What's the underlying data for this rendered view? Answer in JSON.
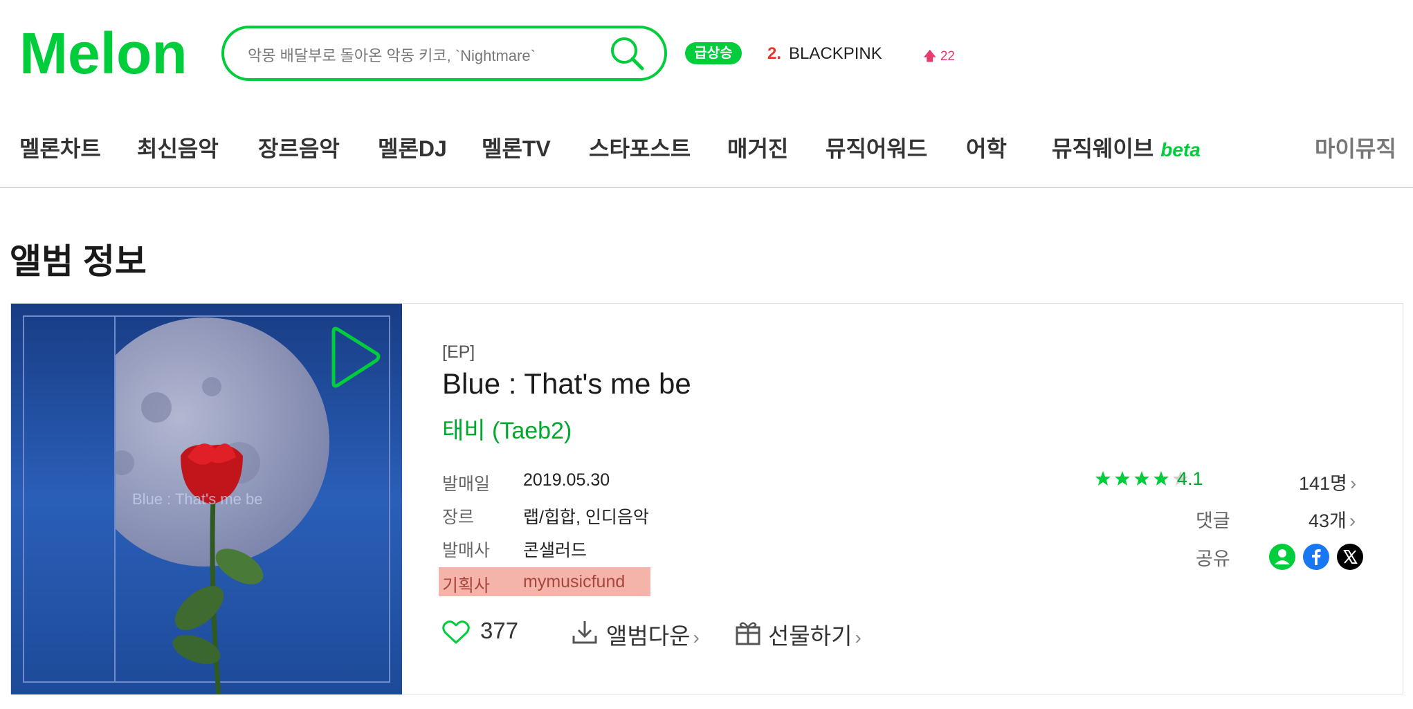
{
  "header": {
    "logo_text": "Melon",
    "search_placeholder": "악몽 배달부로 돌아온 악동 키코, `Nightmare`",
    "rise_badge": "급상승",
    "rank_number": "2.",
    "rank_name": "BLACKPINK",
    "rank_change": "22"
  },
  "nav": {
    "items": [
      "멜론차트",
      "최신음악",
      "장르음악",
      "멜론DJ",
      "멜론TV",
      "스타포스트",
      "매거진",
      "뮤직어워드",
      "어학",
      "뮤직웨이브"
    ],
    "beta_label": "beta",
    "my_music": "마이뮤직"
  },
  "page_title": "앨범 정보",
  "album": {
    "cover_caption": "Blue : That's me be",
    "type": "[EP]",
    "title": "Blue : That's me be",
    "artist": "태비 (Taeb2)",
    "info": [
      {
        "label": "발매일",
        "value": "2019.05.30"
      },
      {
        "label": "장르",
        "value": "랩/힙합, 인디음악"
      },
      {
        "label": "발매사",
        "value": "콘샐러드"
      },
      {
        "label": "기획사",
        "value": "mymusicfund"
      }
    ],
    "likes": "377",
    "download_label": "앨범다운",
    "gift_label": "선물하기",
    "rating": {
      "value": "4.1",
      "stars": 4.5,
      "count": "141명"
    },
    "comments": {
      "label": "댓글",
      "count": "43개"
    },
    "share": {
      "label": "공유",
      "icons": [
        "melon-friend",
        "facebook",
        "x-twitter"
      ]
    }
  },
  "colors": {
    "brand": "#00cd3c",
    "highlight": "#f5b4aa",
    "rank": "#e5362c"
  }
}
